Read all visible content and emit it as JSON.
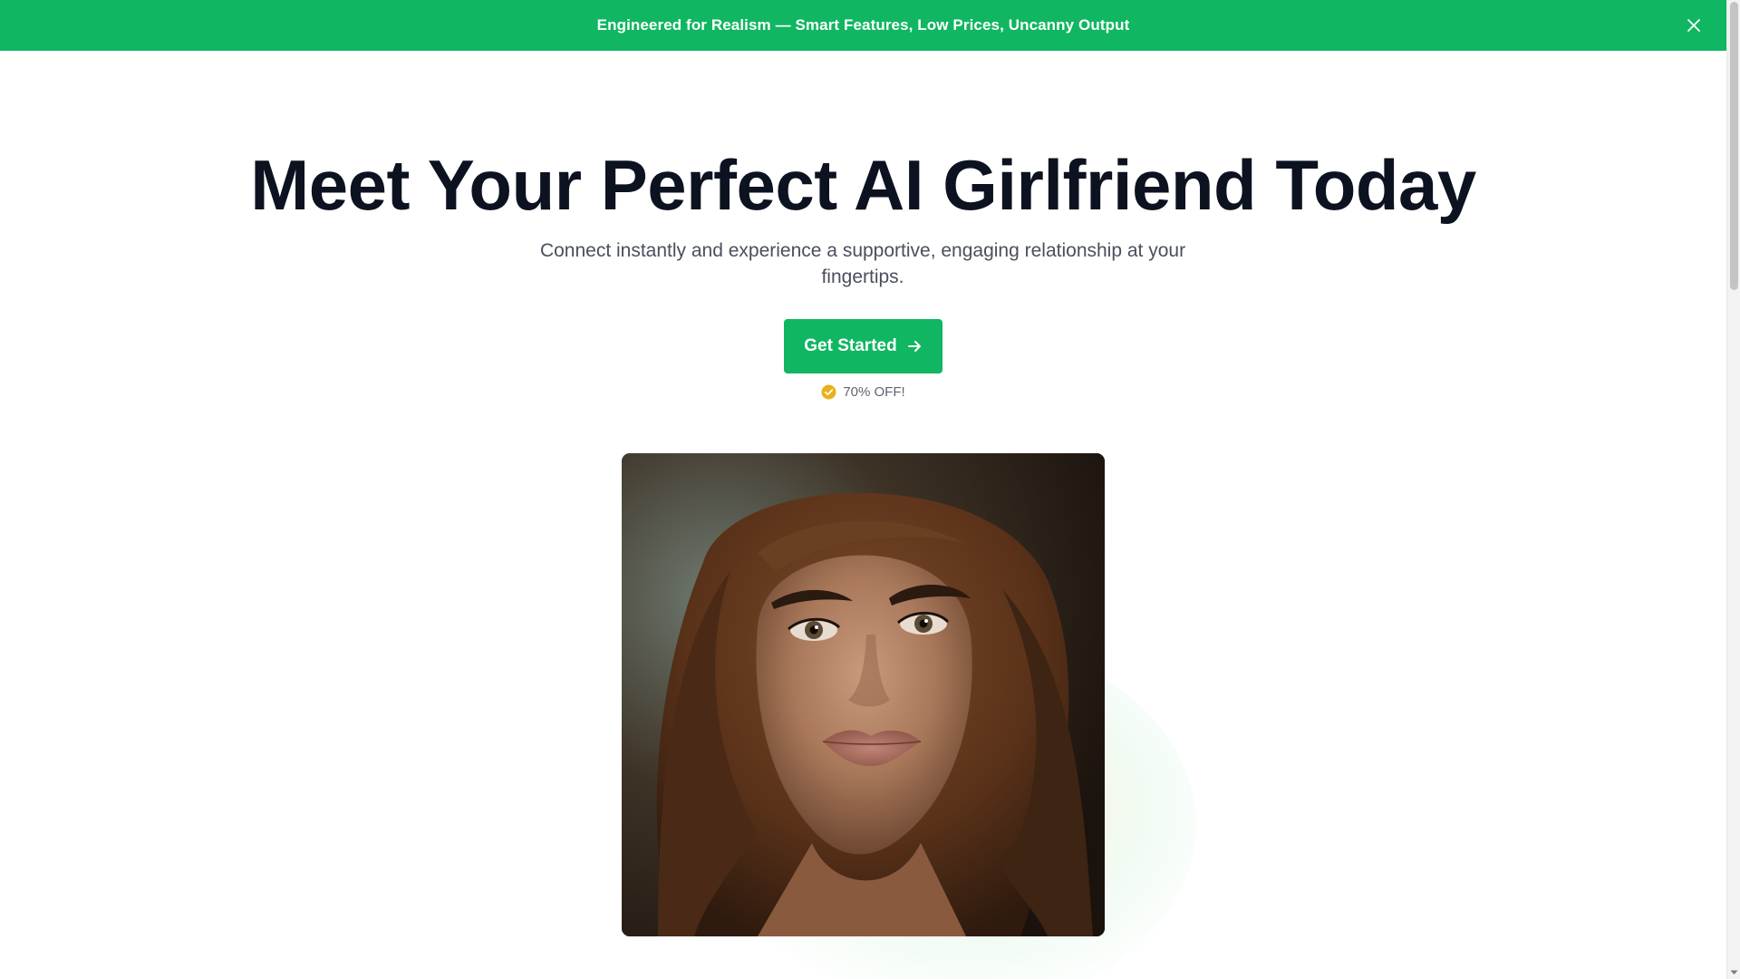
{
  "announcement": {
    "text": "Engineered for Realism — Smart Features, Low Prices, Uncanny Output",
    "close_icon": "close-icon",
    "background": "#10b661"
  },
  "hero": {
    "title": "Meet Your Perfect AI Girlfriend Today",
    "subtitle": "Connect instantly and experience a supportive, engaging relationship at your fingertips.",
    "cta_label": "Get Started",
    "cta_icon": "arrow-right-icon",
    "offer_icon": "check-circle-icon",
    "offer_text": "70% OFF!"
  },
  "portrait": {
    "alt": "portrait-image"
  },
  "colors": {
    "accent": "#10b661",
    "title": "#0d1220",
    "subtitle": "#4a4f5c",
    "offer_badge": "#e8b21c"
  }
}
